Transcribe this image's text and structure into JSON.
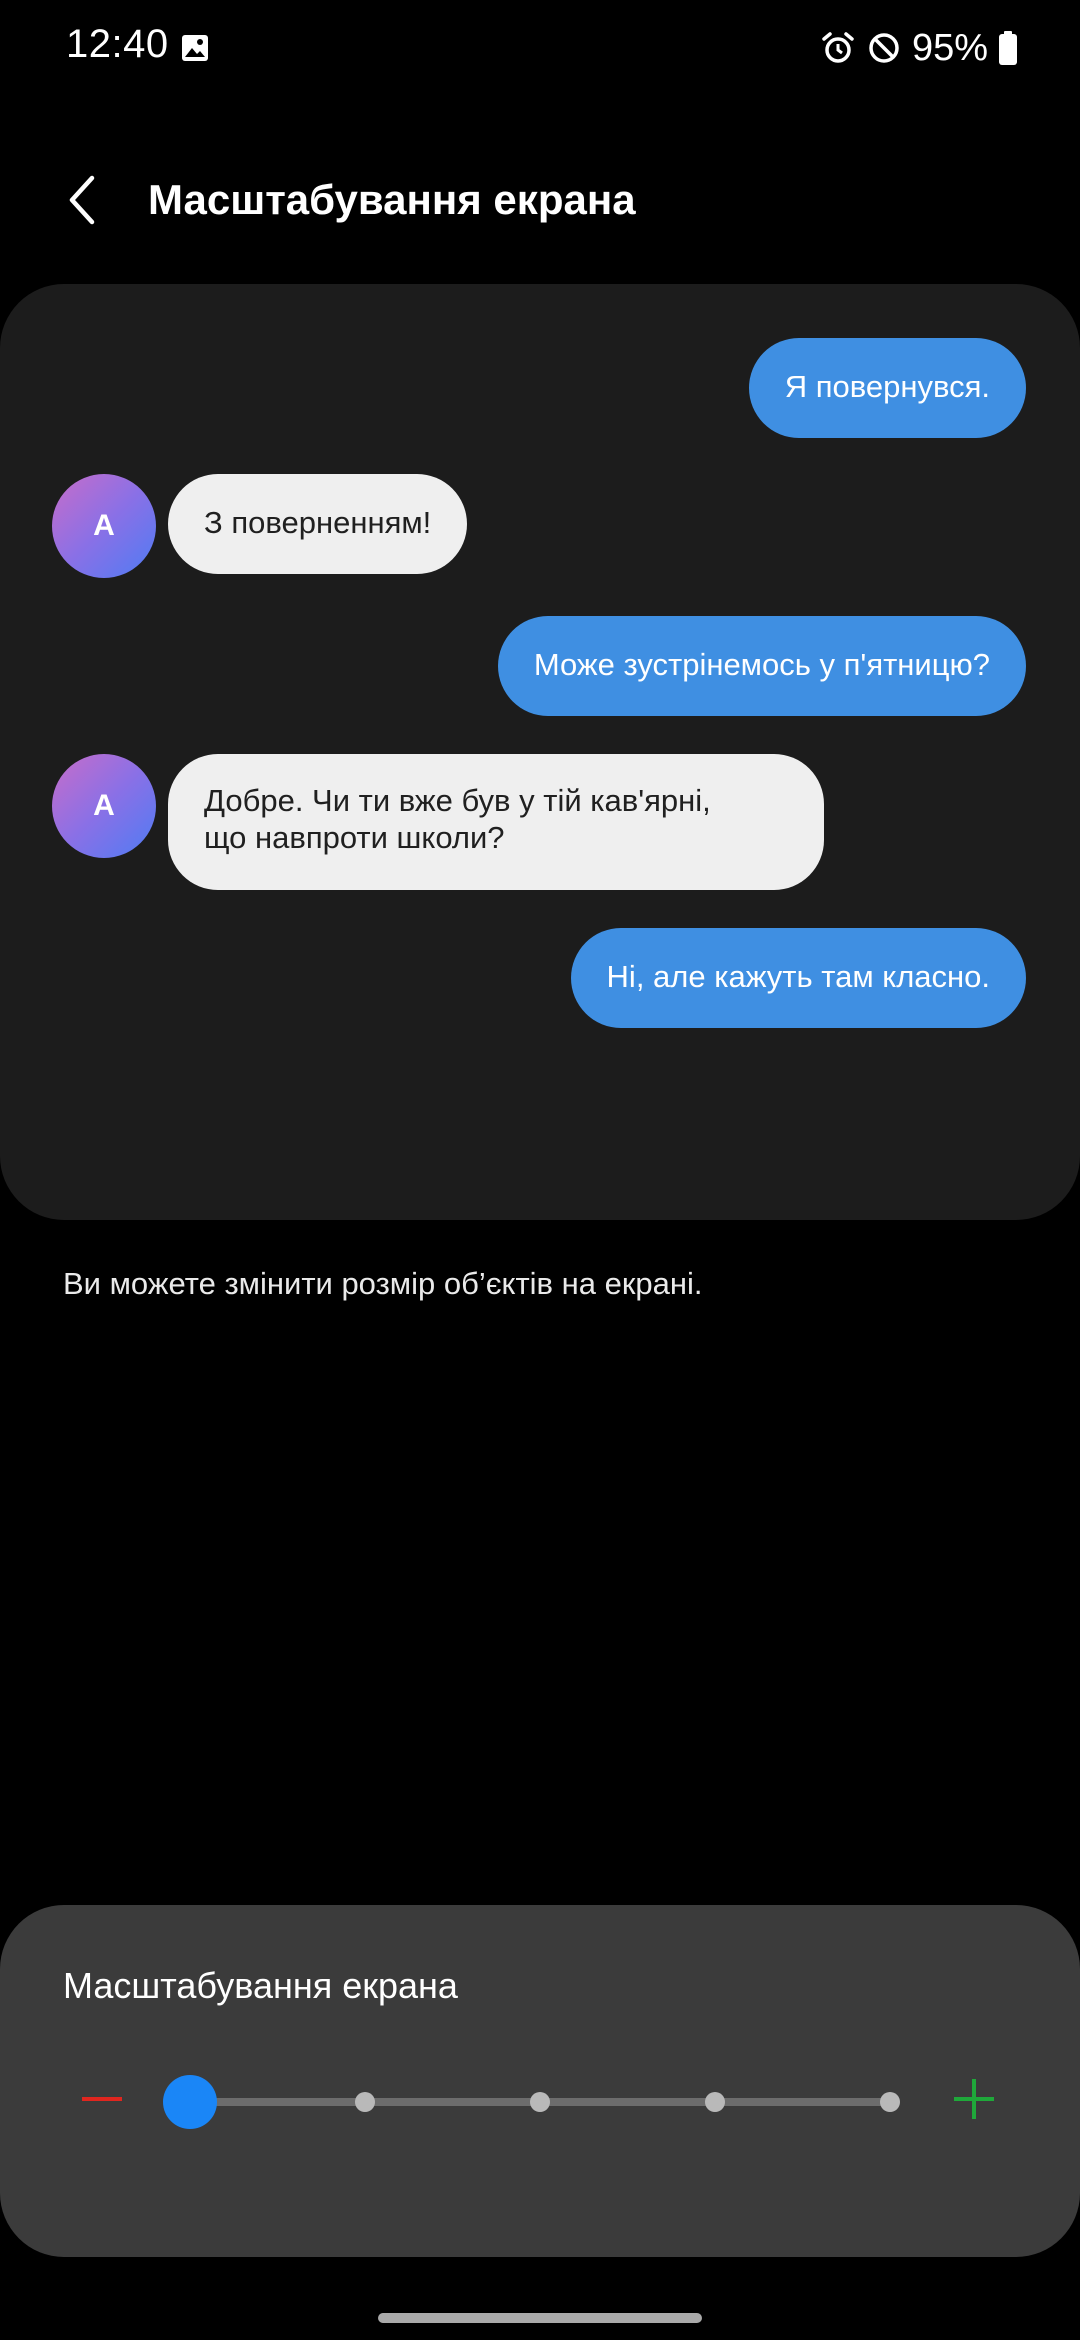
{
  "status_bar": {
    "time": "12:40",
    "battery": "95%",
    "icons": [
      "gallery-icon",
      "alarm-icon",
      "do-not-disturb-icon",
      "battery-icon"
    ]
  },
  "header": {
    "title": "Масштабування екрана",
    "back_icon": "chevron-left-icon"
  },
  "preview": {
    "messages": [
      {
        "side": "out",
        "text": "Я повернувся."
      },
      {
        "side": "in",
        "avatar": "A",
        "text": "З поверненням!"
      },
      {
        "side": "out",
        "text": "Може зустрінемось у п'ятницю?"
      },
      {
        "side": "in",
        "avatar": "A",
        "lines": [
          "Добре. Чи ти вже був у тій кав'ярні,",
          "що навпроти школи?"
        ]
      },
      {
        "side": "out",
        "text": "Ні, але кажуть там класно."
      }
    ]
  },
  "description": "Ви можете змінити розмір об’єктів на екрані.",
  "zoom_panel": {
    "title": "Масштабування екрана",
    "minus_icon": "minus-icon",
    "plus_icon": "plus-icon",
    "slider": {
      "steps": 5,
      "selected_step": 1
    }
  },
  "colors": {
    "accent": "#1a86f7",
    "outgoing_bubble": "#3f8fe2",
    "incoming_bubble": "#efefef",
    "minus": "#e0261f",
    "plus": "#1fa83a"
  }
}
